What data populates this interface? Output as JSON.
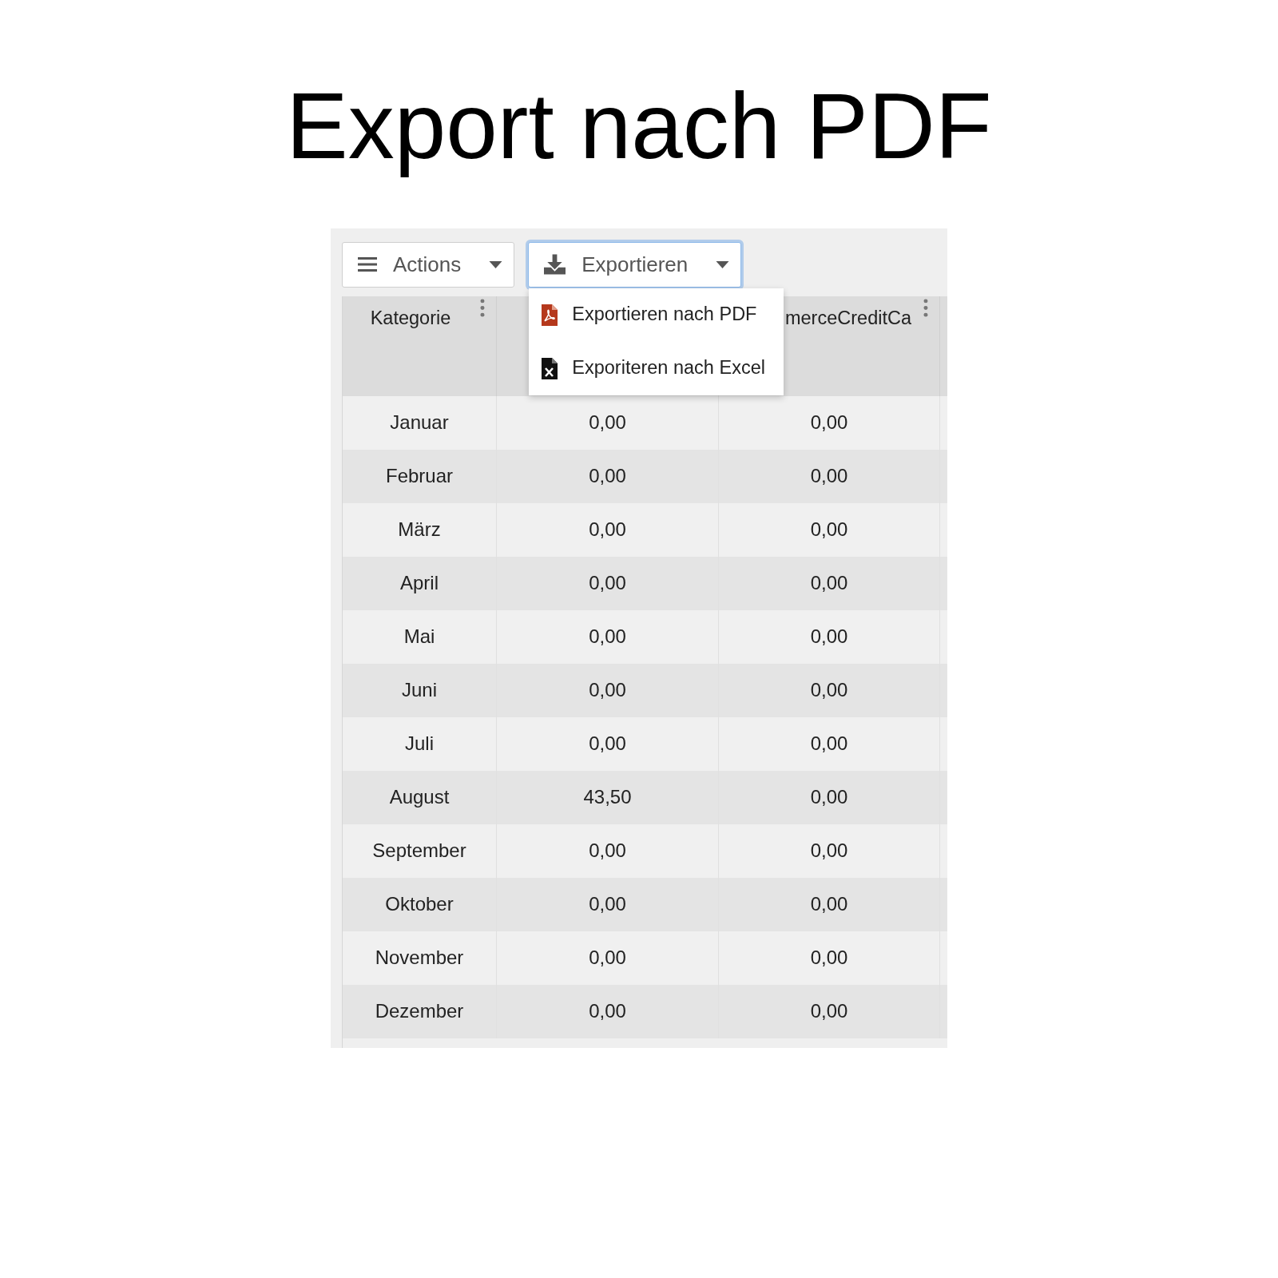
{
  "title": "Export nach PDF",
  "toolbar": {
    "buttons": [
      {
        "kind": "menu",
        "label": "Actions",
        "expanded": false
      },
      {
        "kind": "export",
        "label": "Exportieren",
        "expanded": true,
        "items": [
          {
            "kind": "pdf",
            "label": "Exportieren nach PDF"
          },
          {
            "kind": "excel",
            "label": "Exporiteren nach Excel"
          }
        ]
      }
    ]
  },
  "table": {
    "header": {
      "column_1": "Kategorie",
      "column_3": "merceCreditCa"
    },
    "rows": [
      [
        "Januar",
        "0,00",
        "0,00"
      ],
      [
        "Februar",
        "0,00",
        "0,00"
      ],
      [
        "März",
        "0,00",
        "0,00"
      ],
      [
        "April",
        "0,00",
        "0,00"
      ],
      [
        "Mai",
        "0,00",
        "0,00"
      ],
      [
        "Juni",
        "0,00",
        "0,00"
      ],
      [
        "Juli",
        "0,00",
        "0,00"
      ],
      [
        "August",
        "43,50",
        "0,00"
      ],
      [
        "September",
        "0,00",
        "0,00"
      ],
      [
        "Oktober",
        "0,00",
        "0,00"
      ],
      [
        "November",
        "0,00",
        "0,00"
      ],
      [
        "Dezember",
        "0,00",
        "0,00"
      ]
    ]
  }
}
